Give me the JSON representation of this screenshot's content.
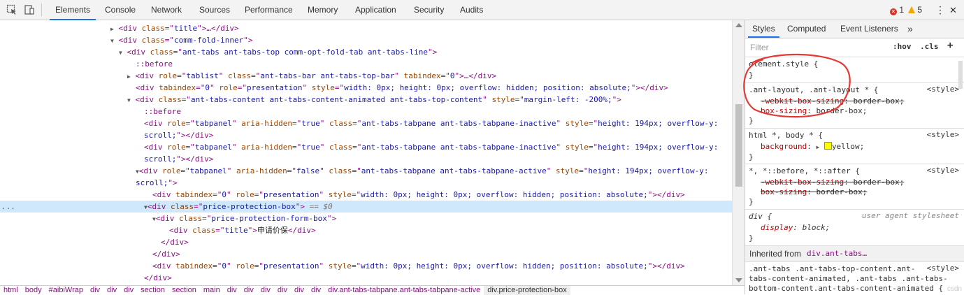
{
  "toolbar": {
    "tabs": [
      "Elements",
      "Console",
      "Network",
      "Sources",
      "Performance",
      "Memory",
      "Application",
      "Security",
      "Audits"
    ],
    "errors": "1",
    "warnings": "5",
    "menu": "⋮",
    "close": "✕"
  },
  "dom": {
    "lines": [
      [
        "▶",
        "<div ",
        "class",
        "=\"",
        "title",
        "\">…</div>"
      ],
      [
        "▼",
        "<div ",
        "class",
        "=\"",
        "comm-fold-inner",
        "\">"
      ],
      [
        "▼",
        "<div ",
        "class",
        "=\"",
        "ant-tabs ant-tabs-top comm-opt-fold-tab ant-tabs-line",
        "\">"
      ],
      [
        "",
        "::before"
      ],
      [
        "▶",
        "<div role=\"tablist\" class=\"ant-tabs-bar ant-tabs-top-bar\" tabindex=\"0\">…</div>"
      ],
      [
        "",
        "<div tabindex=\"0\" role=\"presentation\" style=\"width: 0px; height: 0px; overflow: hidden; position: absolute;\"></div>"
      ],
      [
        "▼",
        "<div class=\"ant-tabs-content ant-tabs-content-animated ant-tabs-top-content\" style=\"margin-left: -200%;\">"
      ],
      [
        "",
        "::before"
      ],
      [
        "",
        "<div role=\"tabpanel\" aria-hidden=\"true\" class=\"ant-tabs-tabpane ant-tabs-tabpane-inactive\" style=\"height: 194px; overflow-y:"
      ],
      [
        "",
        "scroll;\"></div>"
      ],
      [
        "",
        "<div role=\"tabpanel\" aria-hidden=\"true\" class=\"ant-tabs-tabpane ant-tabs-tabpane-inactive\" style=\"height: 194px; overflow-y:"
      ],
      [
        "",
        "scroll;\"></div>"
      ],
      [
        "▼",
        "<div role=\"tabpanel\" aria-hidden=\"false\" class=\"ant-tabs-tabpane ant-tabs-tabpane-active\" style=\"height: 194px; overflow-y:"
      ],
      [
        "",
        "scroll;\">"
      ],
      [
        "",
        "<div tabindex=\"0\" role=\"presentation\" style=\"width: 0px; height: 0px; overflow: hidden; position: absolute;\"></div>"
      ],
      [
        "▼",
        "<div class=\"price-protection-box\">",
        " == $0"
      ],
      [
        "▼",
        "<div class=\"price-protection-form-box\">"
      ],
      [
        "",
        "<div class=\"title\">",
        "申请价保",
        "</div>"
      ],
      [
        "",
        "</div>"
      ],
      [
        "",
        "</div>"
      ],
      [
        "",
        "<div tabindex=\"0\" role=\"presentation\" style=\"width: 0px; height: 0px; overflow: hidden; position: absolute;\"></div>"
      ],
      [
        "",
        "</div>"
      ]
    ],
    "selected_marker": "..."
  },
  "breadcrumb": [
    "html",
    "body",
    "#aibiWrap",
    "div",
    "div",
    "div",
    "section",
    "section",
    "main",
    "div",
    "div",
    "div",
    "div",
    "div",
    "div",
    "div.ant-tabs-tabpane.ant-tabs-tabpane-active",
    "div.price-protection-box"
  ],
  "styles": {
    "tabs": [
      "Styles",
      "Computed",
      "Event Listeners"
    ],
    "more": "»",
    "filter_placeholder": "Filter",
    "hov": ":hov",
    "cls": ".cls",
    "add": "+",
    "rules": [
      {
        "selector": "element.style {",
        "source": "",
        "props": []
      },
      {
        "selector": ".ant-layout, .ant-layout * {",
        "source": "<style>",
        "props": [
          {
            "name": "-webkit-box-sizing",
            "value": "border-box",
            "struck": true
          },
          {
            "name": "box-sizing",
            "value": "border-box",
            "struck": false
          }
        ]
      },
      {
        "selector": "html *, body * {",
        "source": "<style>",
        "props": [
          {
            "name": "background",
            "value": "yellow",
            "struck": false
          }
        ]
      },
      {
        "selector": "*, *::before, *::after {",
        "source": "<style>",
        "props": [
          {
            "name": "-webkit-box-sizing",
            "value": "border-box",
            "struck": true
          },
          {
            "name": "box-sizing",
            "value": "border-box",
            "struck": true
          }
        ]
      },
      {
        "selector": "div {",
        "source": "user agent stylesheet",
        "props": [
          {
            "name": "display",
            "value": "block",
            "struck": false
          }
        ]
      }
    ],
    "inherited_label": "Inherited from",
    "inherited_selector": "div.ant-tabs…",
    "last_rule": [
      ".ant-tabs .ant-tabs-top-content.ant-",
      "tabs-content-animated, .ant-tabs .ant-tabs-",
      "bottom-content.ant-tabs-content-animated {"
    ],
    "last_source": "<style>",
    "watermark": "csdn"
  },
  "colors": {
    "accent": "#1a73e8",
    "annotation": "#e53935"
  }
}
